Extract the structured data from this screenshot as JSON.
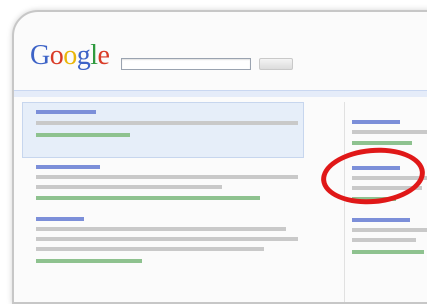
{
  "header": {
    "logo_letters": [
      "G",
      "o",
      "o",
      "g",
      "l",
      "e"
    ],
    "logo_colors": [
      "#3d63c7",
      "#d93b27",
      "#e9b60a",
      "#3d63c7",
      "#2f9a3f",
      "#d93b27"
    ]
  },
  "search": {
    "value": "",
    "button_label": ""
  },
  "annotation": {
    "color": "#e01818"
  }
}
